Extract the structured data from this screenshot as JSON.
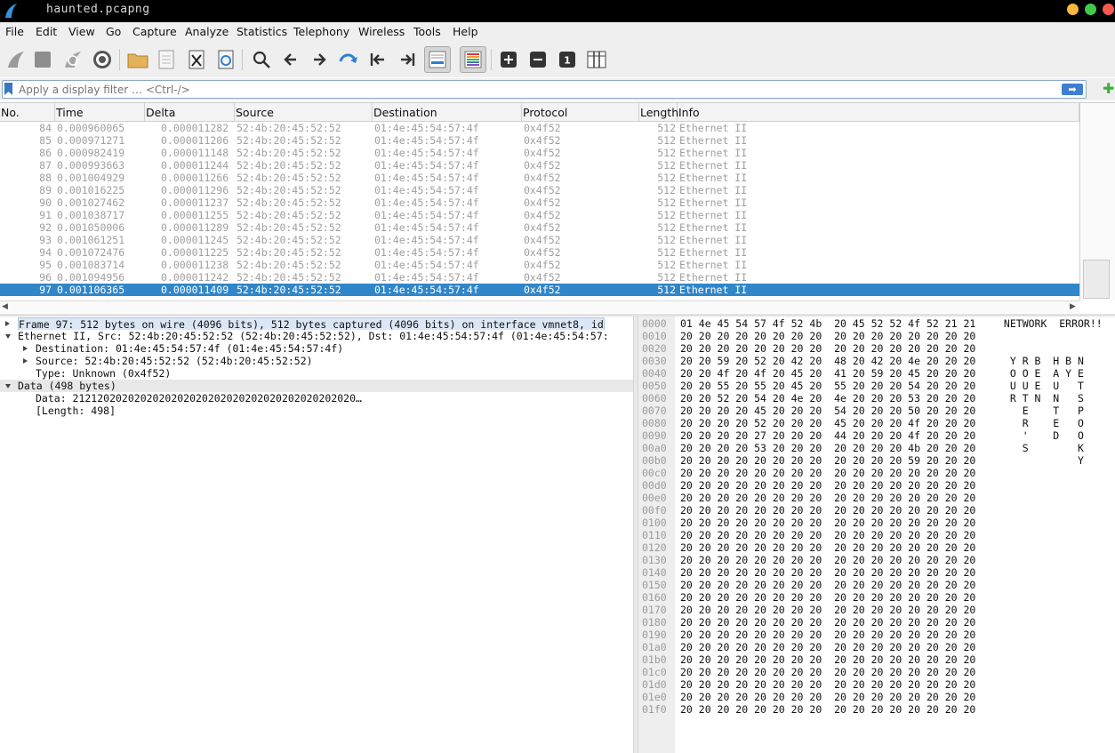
{
  "window": {
    "title": "haunted.pcapng"
  },
  "menu": [
    "File",
    "Edit",
    "View",
    "Go",
    "Capture",
    "Analyze",
    "Statistics",
    "Telephony",
    "Wireless",
    "Tools",
    "Help"
  ],
  "toolbar": {
    "icons": [
      "shark-fin-start-icon",
      "stop-icon",
      "restart-icon",
      "options-gear-icon",
      "open-folder-icon",
      "file-icon",
      "close-file-icon",
      "reload-icon",
      "search-icon",
      "back-arrow-icon",
      "forward-arrow-icon",
      "go-to-packet-icon",
      "first-packet-icon",
      "last-packet-icon",
      "autoscroll-icon",
      "colorize-icon",
      "zoom-in-icon",
      "zoom-out-icon",
      "normal-size-icon",
      "resize-columns-icon"
    ],
    "zoom_normal_label": "1"
  },
  "filter": {
    "placeholder": "Apply a display filter … <Ctrl-/>",
    "apply_arrow": "➡",
    "add": "✚"
  },
  "packet_list": {
    "columns": [
      "No.",
      "Time",
      "Delta",
      "Source",
      "Destination",
      "Protocol",
      "Length",
      "Info"
    ],
    "rows": [
      [
        "84",
        "0.000960065",
        "0.000011282",
        "52:4b:20:45:52:52",
        "01:4e:45:54:57:4f",
        "0x4f52",
        "512",
        "Ethernet II"
      ],
      [
        "85",
        "0.000971271",
        "0.000011206",
        "52:4b:20:45:52:52",
        "01:4e:45:54:57:4f",
        "0x4f52",
        "512",
        "Ethernet II"
      ],
      [
        "86",
        "0.000982419",
        "0.000011148",
        "52:4b:20:45:52:52",
        "01:4e:45:54:57:4f",
        "0x4f52",
        "512",
        "Ethernet II"
      ],
      [
        "87",
        "0.000993663",
        "0.000011244",
        "52:4b:20:45:52:52",
        "01:4e:45:54:57:4f",
        "0x4f52",
        "512",
        "Ethernet II"
      ],
      [
        "88",
        "0.001004929",
        "0.000011266",
        "52:4b:20:45:52:52",
        "01:4e:45:54:57:4f",
        "0x4f52",
        "512",
        "Ethernet II"
      ],
      [
        "89",
        "0.001016225",
        "0.000011296",
        "52:4b:20:45:52:52",
        "01:4e:45:54:57:4f",
        "0x4f52",
        "512",
        "Ethernet II"
      ],
      [
        "90",
        "0.001027462",
        "0.000011237",
        "52:4b:20:45:52:52",
        "01:4e:45:54:57:4f",
        "0x4f52",
        "512",
        "Ethernet II"
      ],
      [
        "91",
        "0.001038717",
        "0.000011255",
        "52:4b:20:45:52:52",
        "01:4e:45:54:57:4f",
        "0x4f52",
        "512",
        "Ethernet II"
      ],
      [
        "92",
        "0.001050006",
        "0.000011289",
        "52:4b:20:45:52:52",
        "01:4e:45:54:57:4f",
        "0x4f52",
        "512",
        "Ethernet II"
      ],
      [
        "93",
        "0.001061251",
        "0.000011245",
        "52:4b:20:45:52:52",
        "01:4e:45:54:57:4f",
        "0x4f52",
        "512",
        "Ethernet II"
      ],
      [
        "94",
        "0.001072476",
        "0.000011225",
        "52:4b:20:45:52:52",
        "01:4e:45:54:57:4f",
        "0x4f52",
        "512",
        "Ethernet II"
      ],
      [
        "95",
        "0.001083714",
        "0.000011238",
        "52:4b:20:45:52:52",
        "01:4e:45:54:57:4f",
        "0x4f52",
        "512",
        "Ethernet II"
      ],
      [
        "96",
        "0.001094956",
        "0.000011242",
        "52:4b:20:45:52:52",
        "01:4e:45:54:57:4f",
        "0x4f52",
        "512",
        "Ethernet II"
      ],
      [
        "97",
        "0.001106365",
        "0.000011409",
        "52:4b:20:45:52:52",
        "01:4e:45:54:57:4f",
        "0x4f52",
        "512",
        "Ethernet II"
      ]
    ],
    "selected_no": "97"
  },
  "details": [
    {
      "expander": "right",
      "indent": 0,
      "text": "Frame 97: 512 bytes on wire (4096 bits), 512 bytes captured (4096 bits) on interface vmnet8, id",
      "style": "sel"
    },
    {
      "expander": "down",
      "indent": 0,
      "text": "Ethernet II, Src: 52:4b:20:45:52:52 (52:4b:20:45:52:52), Dst: 01:4e:45:54:57:4f (01:4e:45:54:57:",
      "style": ""
    },
    {
      "expander": "right",
      "indent": 1,
      "text": "Destination: 01:4e:45:54:57:4f (01:4e:45:54:57:4f)",
      "style": ""
    },
    {
      "expander": "right",
      "indent": 1,
      "text": "Source: 52:4b:20:45:52:52 (52:4b:20:45:52:52)",
      "style": ""
    },
    {
      "expander": "none",
      "indent": 1,
      "text": "Type: Unknown (0x4f52)",
      "style": ""
    },
    {
      "expander": "down",
      "indent": 0,
      "text": "Data (498 bytes)",
      "style": "hl"
    },
    {
      "expander": "none",
      "indent": 1,
      "text": "Data: 2121202020202020202020202020202020202020202020…",
      "style": ""
    },
    {
      "expander": "none",
      "indent": 1,
      "text": "[Length: 498]",
      "style": ""
    }
  ],
  "bytes": [
    [
      "0000",
      "01 4e 45 54 57 4f 52 4b  20 45 52 52 4f 52 21 21",
      " NETWORK  ERROR!!"
    ],
    [
      "0010",
      "20 20 20 20 20 20 20 20  20 20 20 20 20 20 20 20",
      ""
    ],
    [
      "0020",
      "20 20 20 20 20 20 20 20  20 20 20 20 20 20 20 20",
      ""
    ],
    [
      "0030",
      "20 20 59 20 52 20 42 20  48 20 42 20 4e 20 20 20",
      "  Y R B  H B N"
    ],
    [
      "0040",
      "20 20 4f 20 4f 20 45 20  41 20 59 20 45 20 20 20",
      "  O O E  A Y E"
    ],
    [
      "0050",
      "20 20 55 20 55 20 45 20  55 20 20 20 54 20 20 20",
      "  U U E  U   T"
    ],
    [
      "0060",
      "20 20 52 20 54 20 4e 20  4e 20 20 20 53 20 20 20",
      "  R T N  N   S"
    ],
    [
      "0070",
      "20 20 20 20 45 20 20 20  54 20 20 20 50 20 20 20",
      "    E    T   P"
    ],
    [
      "0080",
      "20 20 20 20 52 20 20 20  45 20 20 20 4f 20 20 20",
      "    R    E   O"
    ],
    [
      "0090",
      "20 20 20 20 27 20 20 20  44 20 20 20 4f 20 20 20",
      "    '    D   O"
    ],
    [
      "00a0",
      "20 20 20 20 53 20 20 20  20 20 20 20 4b 20 20 20",
      "    S        K"
    ],
    [
      "00b0",
      "20 20 20 20 20 20 20 20  20 20 20 20 59 20 20 20",
      "             Y"
    ],
    [
      "00c0",
      "20 20 20 20 20 20 20 20  20 20 20 20 20 20 20 20",
      ""
    ],
    [
      "00d0",
      "20 20 20 20 20 20 20 20  20 20 20 20 20 20 20 20",
      ""
    ],
    [
      "00e0",
      "20 20 20 20 20 20 20 20  20 20 20 20 20 20 20 20",
      ""
    ],
    [
      "00f0",
      "20 20 20 20 20 20 20 20  20 20 20 20 20 20 20 20",
      ""
    ],
    [
      "0100",
      "20 20 20 20 20 20 20 20  20 20 20 20 20 20 20 20",
      ""
    ],
    [
      "0110",
      "20 20 20 20 20 20 20 20  20 20 20 20 20 20 20 20",
      ""
    ],
    [
      "0120",
      "20 20 20 20 20 20 20 20  20 20 20 20 20 20 20 20",
      ""
    ],
    [
      "0130",
      "20 20 20 20 20 20 20 20  20 20 20 20 20 20 20 20",
      ""
    ],
    [
      "0140",
      "20 20 20 20 20 20 20 20  20 20 20 20 20 20 20 20",
      ""
    ],
    [
      "0150",
      "20 20 20 20 20 20 20 20  20 20 20 20 20 20 20 20",
      ""
    ],
    [
      "0160",
      "20 20 20 20 20 20 20 20  20 20 20 20 20 20 20 20",
      ""
    ],
    [
      "0170",
      "20 20 20 20 20 20 20 20  20 20 20 20 20 20 20 20",
      ""
    ],
    [
      "0180",
      "20 20 20 20 20 20 20 20  20 20 20 20 20 20 20 20",
      ""
    ],
    [
      "0190",
      "20 20 20 20 20 20 20 20  20 20 20 20 20 20 20 20",
      ""
    ],
    [
      "01a0",
      "20 20 20 20 20 20 20 20  20 20 20 20 20 20 20 20",
      ""
    ],
    [
      "01b0",
      "20 20 20 20 20 20 20 20  20 20 20 20 20 20 20 20",
      ""
    ],
    [
      "01c0",
      "20 20 20 20 20 20 20 20  20 20 20 20 20 20 20 20",
      ""
    ],
    [
      "01d0",
      "20 20 20 20 20 20 20 20  20 20 20 20 20 20 20 20",
      ""
    ],
    [
      "01e0",
      "20 20 20 20 20 20 20 20  20 20 20 20 20 20 20 20",
      ""
    ],
    [
      "01f0",
      "20 20 20 20 20 20 20 20  20 20 20 20 20 20 20 20",
      ""
    ]
  ],
  "colors": {
    "selection": "#2f86c9",
    "title_bg": "#000000",
    "chrome_bg": "#efefef"
  }
}
